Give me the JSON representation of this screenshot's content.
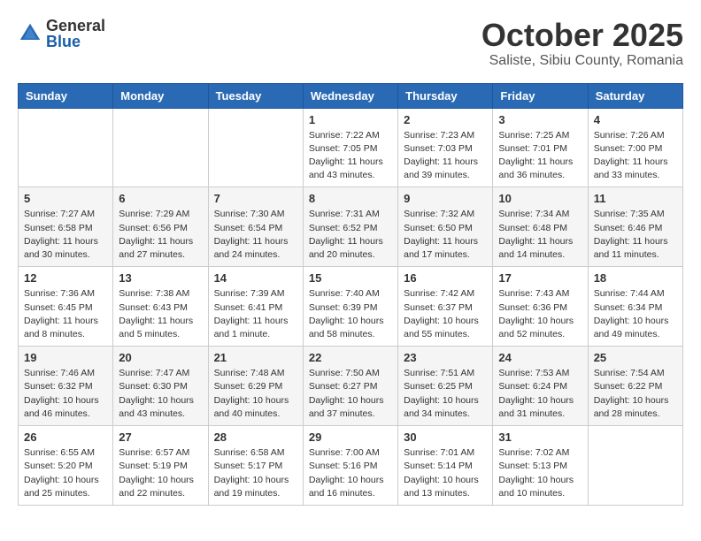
{
  "logo": {
    "general": "General",
    "blue": "Blue"
  },
  "title": "October 2025",
  "subtitle": "Saliste, Sibiu County, Romania",
  "weekdays": [
    "Sunday",
    "Monday",
    "Tuesday",
    "Wednesday",
    "Thursday",
    "Friday",
    "Saturday"
  ],
  "weeks": [
    [
      {
        "day": "",
        "info": ""
      },
      {
        "day": "",
        "info": ""
      },
      {
        "day": "",
        "info": ""
      },
      {
        "day": "1",
        "info": "Sunrise: 7:22 AM\nSunset: 7:05 PM\nDaylight: 11 hours\nand 43 minutes."
      },
      {
        "day": "2",
        "info": "Sunrise: 7:23 AM\nSunset: 7:03 PM\nDaylight: 11 hours\nand 39 minutes."
      },
      {
        "day": "3",
        "info": "Sunrise: 7:25 AM\nSunset: 7:01 PM\nDaylight: 11 hours\nand 36 minutes."
      },
      {
        "day": "4",
        "info": "Sunrise: 7:26 AM\nSunset: 7:00 PM\nDaylight: 11 hours\nand 33 minutes."
      }
    ],
    [
      {
        "day": "5",
        "info": "Sunrise: 7:27 AM\nSunset: 6:58 PM\nDaylight: 11 hours\nand 30 minutes."
      },
      {
        "day": "6",
        "info": "Sunrise: 7:29 AM\nSunset: 6:56 PM\nDaylight: 11 hours\nand 27 minutes."
      },
      {
        "day": "7",
        "info": "Sunrise: 7:30 AM\nSunset: 6:54 PM\nDaylight: 11 hours\nand 24 minutes."
      },
      {
        "day": "8",
        "info": "Sunrise: 7:31 AM\nSunset: 6:52 PM\nDaylight: 11 hours\nand 20 minutes."
      },
      {
        "day": "9",
        "info": "Sunrise: 7:32 AM\nSunset: 6:50 PM\nDaylight: 11 hours\nand 17 minutes."
      },
      {
        "day": "10",
        "info": "Sunrise: 7:34 AM\nSunset: 6:48 PM\nDaylight: 11 hours\nand 14 minutes."
      },
      {
        "day": "11",
        "info": "Sunrise: 7:35 AM\nSunset: 6:46 PM\nDaylight: 11 hours\nand 11 minutes."
      }
    ],
    [
      {
        "day": "12",
        "info": "Sunrise: 7:36 AM\nSunset: 6:45 PM\nDaylight: 11 hours\nand 8 minutes."
      },
      {
        "day": "13",
        "info": "Sunrise: 7:38 AM\nSunset: 6:43 PM\nDaylight: 11 hours\nand 5 minutes."
      },
      {
        "day": "14",
        "info": "Sunrise: 7:39 AM\nSunset: 6:41 PM\nDaylight: 11 hours\nand 1 minute."
      },
      {
        "day": "15",
        "info": "Sunrise: 7:40 AM\nSunset: 6:39 PM\nDaylight: 10 hours\nand 58 minutes."
      },
      {
        "day": "16",
        "info": "Sunrise: 7:42 AM\nSunset: 6:37 PM\nDaylight: 10 hours\nand 55 minutes."
      },
      {
        "day": "17",
        "info": "Sunrise: 7:43 AM\nSunset: 6:36 PM\nDaylight: 10 hours\nand 52 minutes."
      },
      {
        "day": "18",
        "info": "Sunrise: 7:44 AM\nSunset: 6:34 PM\nDaylight: 10 hours\nand 49 minutes."
      }
    ],
    [
      {
        "day": "19",
        "info": "Sunrise: 7:46 AM\nSunset: 6:32 PM\nDaylight: 10 hours\nand 46 minutes."
      },
      {
        "day": "20",
        "info": "Sunrise: 7:47 AM\nSunset: 6:30 PM\nDaylight: 10 hours\nand 43 minutes."
      },
      {
        "day": "21",
        "info": "Sunrise: 7:48 AM\nSunset: 6:29 PM\nDaylight: 10 hours\nand 40 minutes."
      },
      {
        "day": "22",
        "info": "Sunrise: 7:50 AM\nSunset: 6:27 PM\nDaylight: 10 hours\nand 37 minutes."
      },
      {
        "day": "23",
        "info": "Sunrise: 7:51 AM\nSunset: 6:25 PM\nDaylight: 10 hours\nand 34 minutes."
      },
      {
        "day": "24",
        "info": "Sunrise: 7:53 AM\nSunset: 6:24 PM\nDaylight: 10 hours\nand 31 minutes."
      },
      {
        "day": "25",
        "info": "Sunrise: 7:54 AM\nSunset: 6:22 PM\nDaylight: 10 hours\nand 28 minutes."
      }
    ],
    [
      {
        "day": "26",
        "info": "Sunrise: 6:55 AM\nSunset: 5:20 PM\nDaylight: 10 hours\nand 25 minutes."
      },
      {
        "day": "27",
        "info": "Sunrise: 6:57 AM\nSunset: 5:19 PM\nDaylight: 10 hours\nand 22 minutes."
      },
      {
        "day": "28",
        "info": "Sunrise: 6:58 AM\nSunset: 5:17 PM\nDaylight: 10 hours\nand 19 minutes."
      },
      {
        "day": "29",
        "info": "Sunrise: 7:00 AM\nSunset: 5:16 PM\nDaylight: 10 hours\nand 16 minutes."
      },
      {
        "day": "30",
        "info": "Sunrise: 7:01 AM\nSunset: 5:14 PM\nDaylight: 10 hours\nand 13 minutes."
      },
      {
        "day": "31",
        "info": "Sunrise: 7:02 AM\nSunset: 5:13 PM\nDaylight: 10 hours\nand 10 minutes."
      },
      {
        "day": "",
        "info": ""
      }
    ]
  ]
}
